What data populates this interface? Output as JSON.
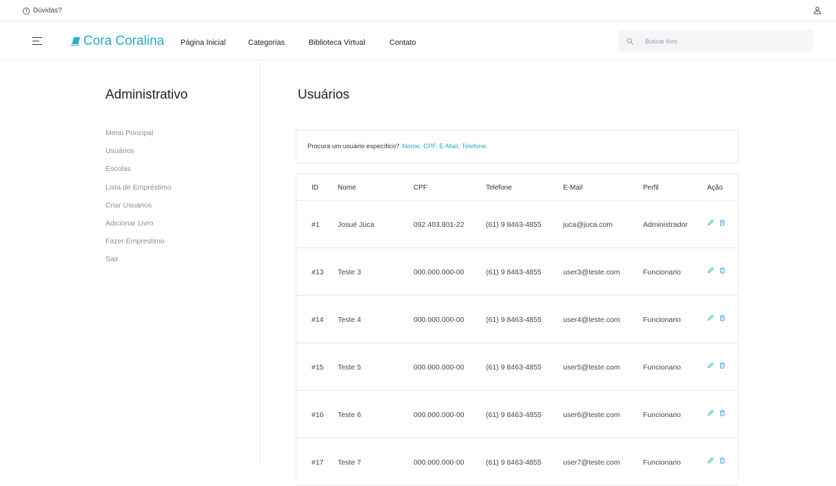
{
  "topbar": {
    "help_label": "Dúvidas?"
  },
  "navbar": {
    "brand": "Cora Coralina",
    "links": [
      "Página Inicial",
      "Categorias",
      "Biblioteca Virtual",
      "Contato"
    ],
    "search_placeholder": "Buscar livro"
  },
  "sidebar": {
    "title": "Administrativo",
    "items": [
      "Menu Principal",
      "Usuários",
      "Escolas",
      "Lista de Empréstimo",
      "Criar Usuários",
      "Adicionar Livro",
      "Fazer Emprestimo",
      "Sair"
    ]
  },
  "main": {
    "title": "Usuários",
    "search_hint": "Procura um usuário específico?",
    "search_hint_links": "Nome, CPF, E-Mail, Telefone."
  },
  "table": {
    "headers": [
      "ID",
      "Nome",
      "CPF",
      "Telefone",
      "E-Mail",
      "Perfil",
      "Ação"
    ],
    "rows": [
      [
        "#1",
        "Josué Juca",
        "092.403.801-22",
        "(61) 9 8463-4855",
        "juca@juca.com",
        "Administrador"
      ],
      [
        "#13",
        "Teste 3",
        "000.000.000-00",
        "(61) 9 8463-4855",
        "user3@teste.com",
        "Funcionario"
      ],
      [
        "#14",
        "Teste 4",
        "000.000.000-00",
        "(61) 9 8463-4855",
        "user4@teste.com",
        "Funcionario"
      ],
      [
        "#15",
        "Teste 5",
        "000.000.000-00",
        "(61) 9 8463-4855",
        "user5@teste.com",
        "Funcionario"
      ],
      [
        "#16",
        "Teste 6",
        "000.000.000-00",
        "(61) 9 8463-4855",
        "user6@teste.com",
        "Funcionario"
      ],
      [
        "#17",
        "Teste 7",
        "000.000.000-00",
        "(61) 9 8463-4855",
        "user7@teste.com",
        "Funcionario"
      ]
    ]
  },
  "icons": {
    "help": "help-circle-icon",
    "user": "user-icon",
    "menu": "hamburger-menu-icon",
    "brand": "book-icon",
    "search": "search-icon",
    "edit": "pencil-icon",
    "delete": "trash-icon"
  },
  "colors": {
    "accent": "#2ba9c7",
    "text": "#333333",
    "muted": "#8e8e8e",
    "border": "#e6e6e6"
  }
}
